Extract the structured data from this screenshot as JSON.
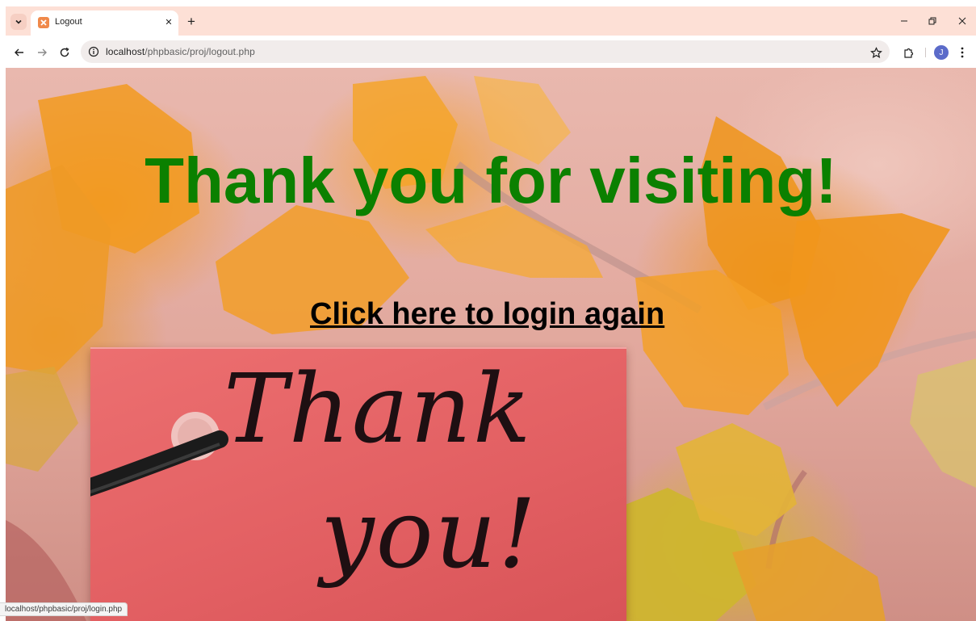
{
  "tab": {
    "title": "Logout",
    "close_symbol": "✕"
  },
  "new_tab_symbol": "+",
  "address_bar": {
    "host": "localhost",
    "path": "/phpbasic/proj/logout.php"
  },
  "profile": {
    "initial": "J"
  },
  "page": {
    "headline": "Thank you for visiting!",
    "login_link": "Click here to login again",
    "tag_text_line1": "Thank",
    "tag_text_line2": "you!"
  },
  "status_bar": {
    "url": "localhost/phpbasic/proj/login.php"
  },
  "colors": {
    "headline": "#0b8000",
    "link": "#000000",
    "tab_strip": "#fde0d6",
    "tag": "#e25f62"
  }
}
